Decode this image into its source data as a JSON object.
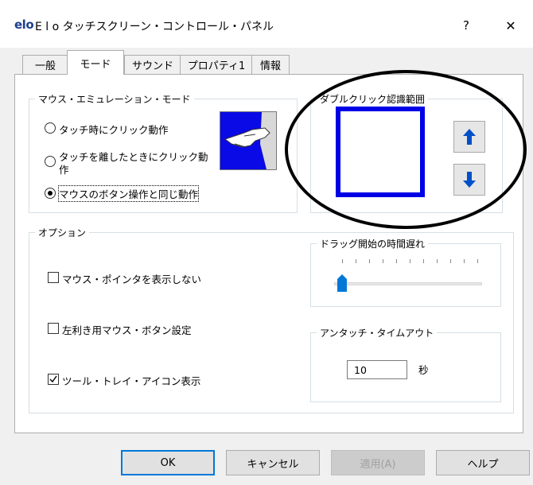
{
  "window": {
    "logo_text": "elo",
    "title": "E l o タッチスクリーン・コントロール・パネル",
    "help_label": "?",
    "close_label": "✕"
  },
  "tabs": [
    {
      "label": "一般",
      "active": false
    },
    {
      "label": "モード",
      "active": true
    },
    {
      "label": "サウンド",
      "active": false
    },
    {
      "label": "プロパティ1",
      "active": false
    },
    {
      "label": "情報",
      "active": false
    }
  ],
  "mouse_emulation": {
    "legend": "マウス・エミュレーション・モード",
    "options": [
      {
        "label": "タッチ時にクリック動作",
        "checked": false
      },
      {
        "label": "タッチを離したときにクリック動作",
        "checked": false
      },
      {
        "label": "マウスのボタン操作と同じ動作",
        "checked": true
      }
    ],
    "illustration_icon": "touch-hand-icon"
  },
  "double_click": {
    "legend": "ダブルクリック認識範囲",
    "box_color": "#0000e6",
    "up_icon": "arrow-up-icon",
    "down_icon": "arrow-down-icon"
  },
  "options": {
    "legend": "オプション",
    "checkboxes": [
      {
        "label": "マウス・ポインタを表示しない",
        "checked": false
      },
      {
        "label": "左利き用マウス・ボタン設定",
        "checked": false
      },
      {
        "label": "ツール・トレイ・アイコン表示",
        "checked": true
      }
    ]
  },
  "drag_delay": {
    "legend": "ドラッグ開始の時間遅れ",
    "level": 0
  },
  "untouch_timeout": {
    "legend": "アンタッチ・タイムアウト",
    "value": "10",
    "unit": "秒"
  },
  "buttons": {
    "ok": "OK",
    "cancel": "キャンセル",
    "apply": "適用(A)",
    "help": "ヘルプ"
  },
  "colors": {
    "accent": "#0078d7",
    "arrow": "#0050c8"
  }
}
